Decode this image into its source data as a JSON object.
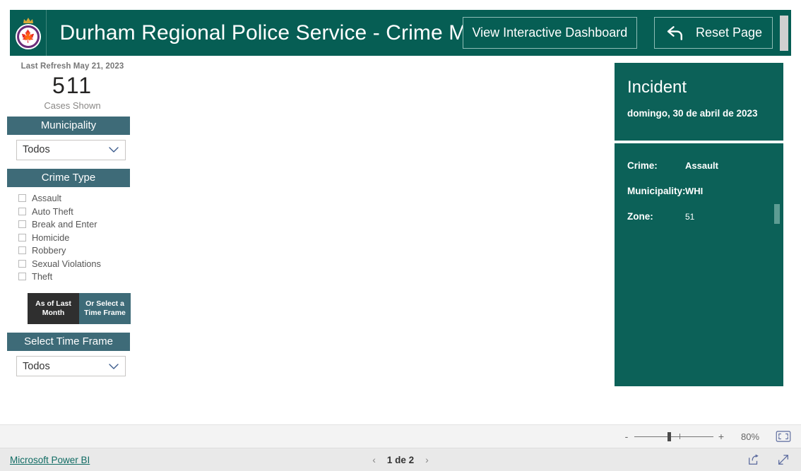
{
  "header": {
    "logo_icon": "durham-police-badge-icon",
    "title": "Durham Regional Police Service - Crime Map",
    "dashboard_button": "View Interactive Dashboard",
    "reset_button": "Reset Page",
    "reset_icon": "undo-arrow-icon"
  },
  "sidebar": {
    "last_refresh": "Last Refresh May 21, 2023",
    "kpi_value": "511",
    "kpi_label": "Cases Shown",
    "municipality_header": "Municipality",
    "municipality_value": "Todos",
    "crime_type_header": "Crime Type",
    "crime_types": [
      {
        "label": "Assault",
        "checked": false
      },
      {
        "label": "Auto Theft",
        "checked": false
      },
      {
        "label": "Break and Enter",
        "checked": false
      },
      {
        "label": "Homicide",
        "checked": false
      },
      {
        "label": "Robbery",
        "checked": false
      },
      {
        "label": "Sexual Violations",
        "checked": false
      },
      {
        "label": "Theft",
        "checked": false
      }
    ],
    "toggle_left": "As of Last Month",
    "toggle_right": "Or Select a Time Frame",
    "timeframe_header": "Select Time Frame",
    "timeframe_value": "Todos"
  },
  "incident": {
    "title": "Incident",
    "date": "domingo, 30 de abril de 2023",
    "fields": [
      {
        "key": "Crime:",
        "value": "Assault"
      },
      {
        "key": "Municipality:",
        "value": "WHI"
      },
      {
        "key": "Zone:",
        "value": "51"
      }
    ]
  },
  "zoombar": {
    "minus": "-",
    "plus": "+",
    "percent": "80%",
    "fit_icon": "fit-to-page-icon"
  },
  "footer": {
    "brand_link": "Microsoft Power BI",
    "prev_icon": "chevron-left-icon",
    "page_text": "1 de 2",
    "next_icon": "chevron-right-icon",
    "share_icon": "share-icon",
    "fullscreen_icon": "expand-arrow-icon"
  },
  "colors": {
    "header_teal": "#065e54",
    "incident_teal": "#0c6158",
    "section_slate": "#3e6b78",
    "toggle_active": "#2f2f2f",
    "link_teal": "#0f6b63"
  }
}
